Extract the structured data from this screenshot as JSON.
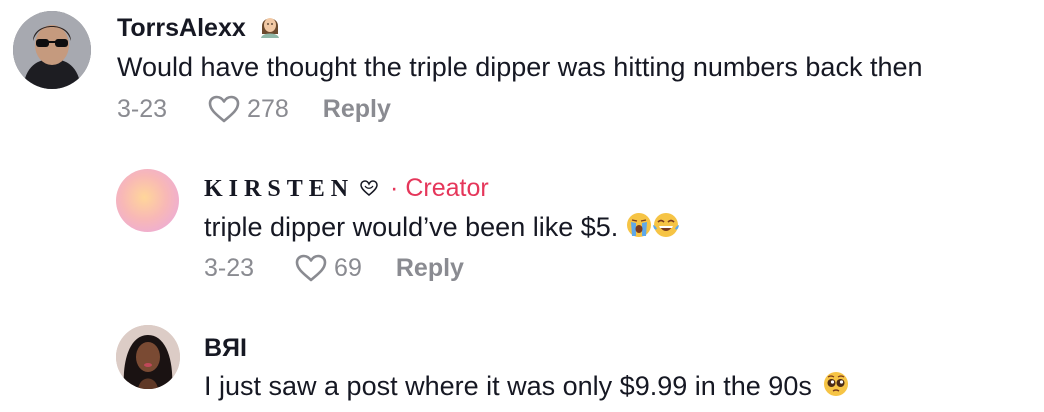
{
  "comments": [
    {
      "username": "TorrsAlexx",
      "text": "Would have thought the triple dipper was hitting numbers back then",
      "date": "3-23",
      "likes": "278",
      "reply_label": "Reply",
      "badge_emoji": "woman-emoji"
    },
    {
      "username": "KIRSTEN",
      "creator_label": "· Creator",
      "text": "triple dipper would’ve been like $5.",
      "date": "3-23",
      "likes": "69",
      "reply_label": "Reply",
      "emojis": [
        "loudly-crying-face-emoji",
        "tears-of-joy-emoji"
      ]
    },
    {
      "username": "BЯI",
      "text": "I just saw a post where it was only $9.99 in the 90s",
      "emojis": [
        "pleading-face-emoji"
      ]
    }
  ],
  "colors": {
    "primary_text": "#161823",
    "secondary_text": "#8a8b91",
    "creator": "#e5365a"
  }
}
